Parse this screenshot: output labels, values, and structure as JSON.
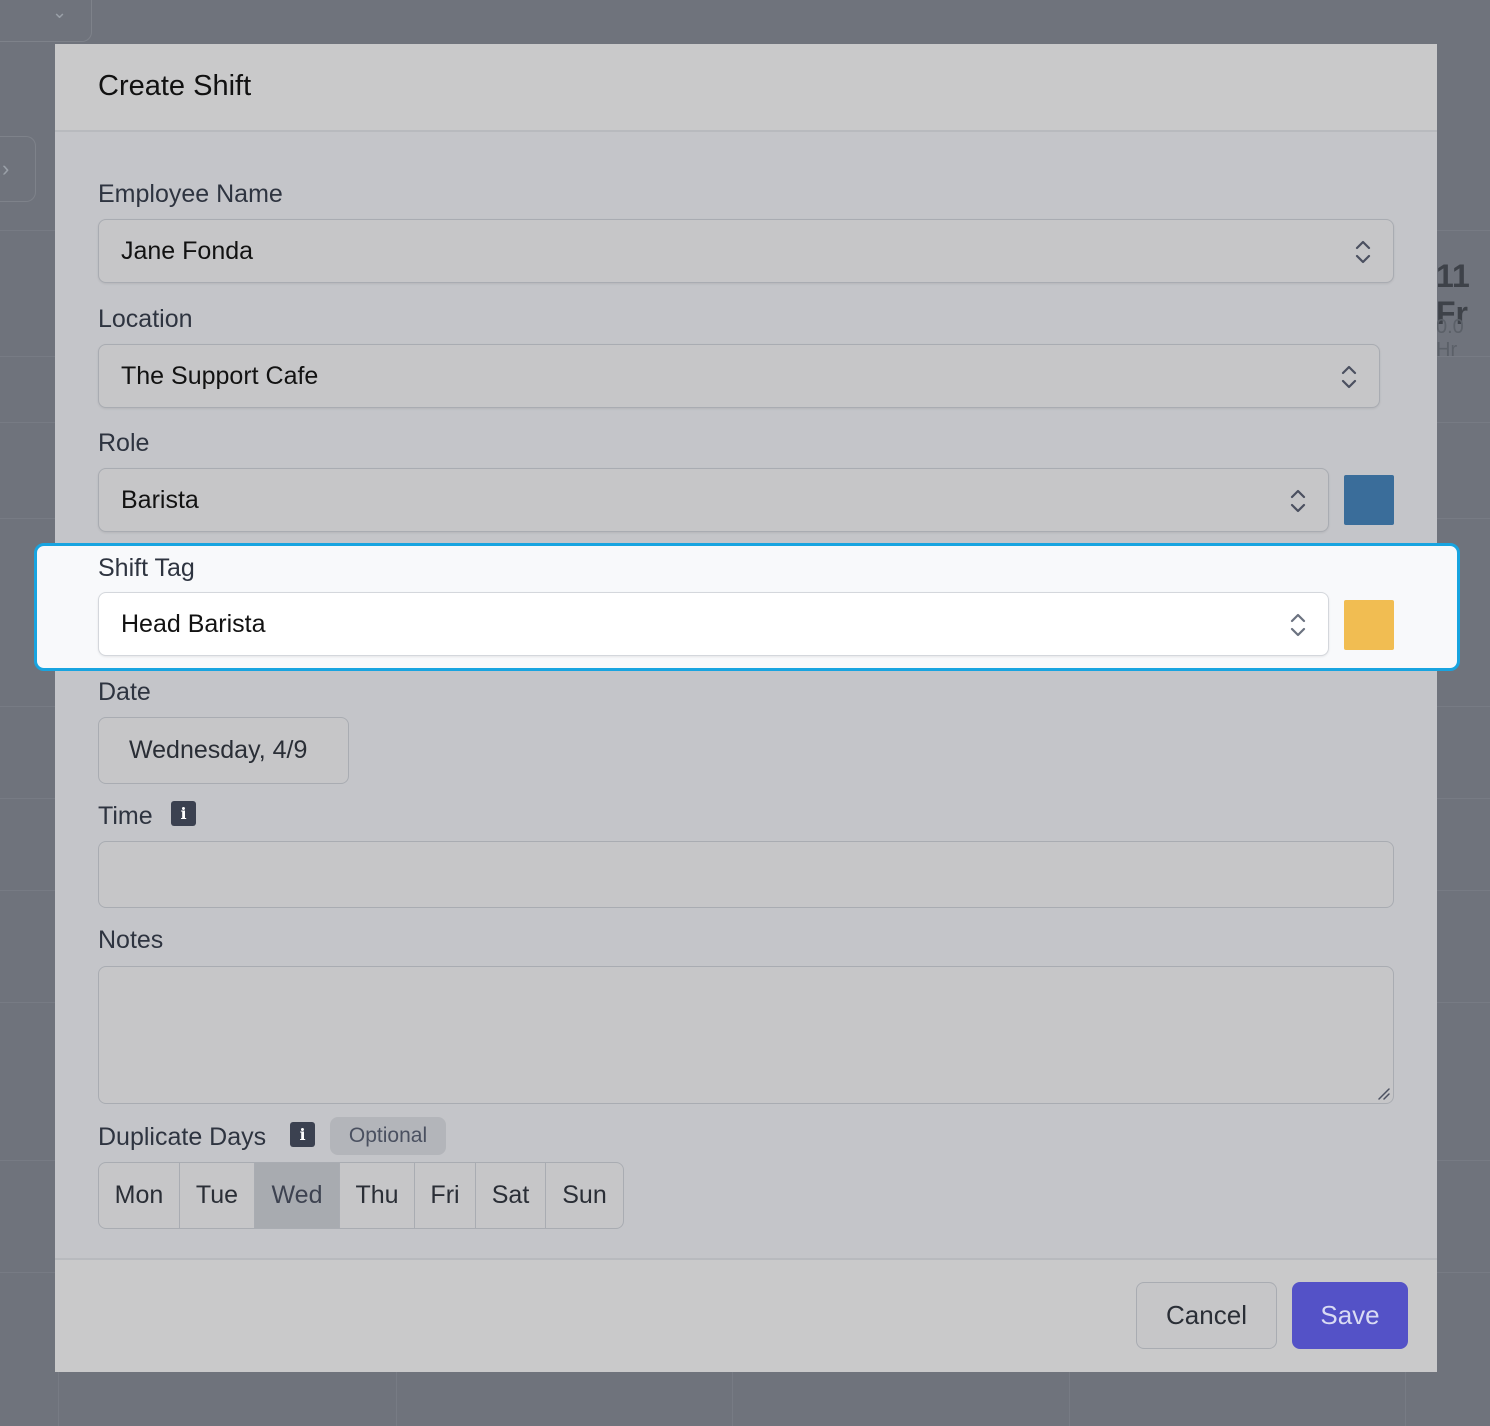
{
  "background": {
    "day_header": "11 Fr",
    "hours": "0.0 Hr"
  },
  "modal": {
    "title": "Create Shift",
    "employee": {
      "label": "Employee Name",
      "value": "Jane Fonda"
    },
    "location": {
      "label": "Location",
      "value": "The Support Cafe"
    },
    "role": {
      "label": "Role",
      "value": "Barista",
      "color": "#3a6d9a"
    },
    "shift_tag": {
      "label": "Shift Tag",
      "value": "Head Barista",
      "color": "#f1bd52"
    },
    "date": {
      "label": "Date",
      "value": "Wednesday, 4/9"
    },
    "time": {
      "label": "Time",
      "value": ""
    },
    "notes": {
      "label": "Notes",
      "value": ""
    },
    "duplicate_days": {
      "label": "Duplicate Days",
      "badge": "Optional",
      "days": [
        "Mon",
        "Tue",
        "Wed",
        "Thu",
        "Fri",
        "Sat",
        "Sun"
      ],
      "selected": "Wed"
    },
    "buttons": {
      "cancel": "Cancel",
      "save": "Save"
    }
  },
  "icons": {
    "info": "info-icon",
    "select": "chevron-up-down-icon",
    "resize": "resize-handle-icon"
  },
  "colors": {
    "accent": "#5452c7",
    "highlight_border": "#18a4e0"
  }
}
